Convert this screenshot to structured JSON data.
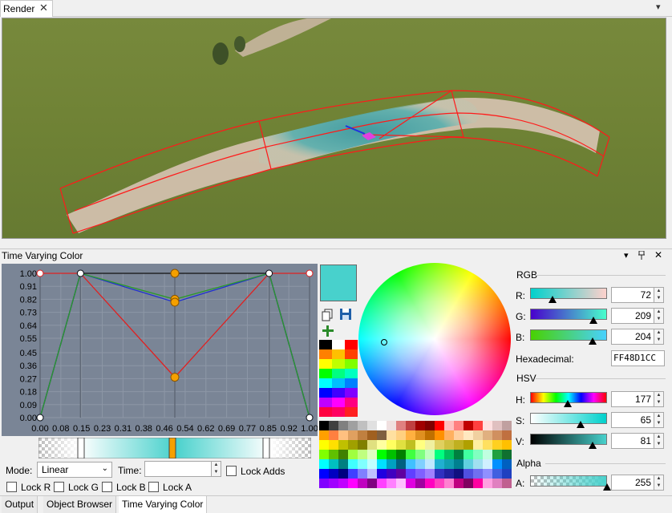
{
  "render_panel": {
    "tab_label": "Render",
    "close_glyph": "✕",
    "menu_glyph": "▾"
  },
  "tool_panel": {
    "title": "Time Varying Color",
    "header_buttons": {
      "menu": "▾",
      "pin": "📌",
      "close": "✕"
    }
  },
  "graph": {
    "y_ticks": [
      "1.00",
      "0.91",
      "0.82",
      "0.73",
      "0.64",
      "0.55",
      "0.45",
      "0.36",
      "0.27",
      "0.18",
      "0.09",
      "0.00"
    ],
    "x_ticks": [
      "0.00",
      "0.08",
      "0.15",
      "0.23",
      "0.31",
      "0.38",
      "0.46",
      "0.54",
      "0.62",
      "0.69",
      "0.77",
      "0.85",
      "0.92",
      "1.00"
    ],
    "keys": [
      {
        "t": 0.0,
        "r": 1.0,
        "g": 0.0,
        "b": 0.0,
        "a": 0.0
      },
      {
        "t": 0.15,
        "r": 1.0,
        "g": 1.0,
        "b": 1.0,
        "a": 1.0
      },
      {
        "t": 0.5,
        "r": 0.28,
        "g": 0.82,
        "b": 0.8,
        "a": 1.0
      },
      {
        "t": 0.85,
        "r": 1.0,
        "g": 1.0,
        "b": 1.0,
        "a": 1.0
      },
      {
        "t": 1.0,
        "r": 1.0,
        "g": 0.0,
        "b": 0.0,
        "a": 0.0
      }
    ],
    "colors": {
      "red": "#e02020",
      "green": "#2b9a2b",
      "blue": "#2030d0",
      "alpha": "#111111",
      "selected": "#f5a000"
    }
  },
  "controls": {
    "mode_label": "Mode:",
    "mode_value": "Linear",
    "time_label": "Time:",
    "time_value": "",
    "lock_adds": "Lock Adds",
    "lock_r": "Lock R",
    "lock_g": "Lock G",
    "lock_b": "Lock B",
    "lock_a": "Lock A"
  },
  "color": {
    "current": "#48d1cc",
    "rgb_title": "RGB",
    "r_label": "R:",
    "r_value": "72",
    "g_label": "G:",
    "g_value": "209",
    "b_label": "B:",
    "b_value": "204",
    "hex_label": "Hexadecimal:",
    "hex_value": "FF48D1CC",
    "hsv_title": "HSV",
    "h_label": "H:",
    "h_value": "177",
    "s_label": "S:",
    "s_value": "65",
    "v_label": "V:",
    "v_value": "81",
    "alpha_title": "Alpha",
    "a_label": "A:",
    "a_value": "255"
  },
  "bottom_tabs": [
    "Output",
    "Object Browser",
    "Time Varying Color"
  ],
  "icons": {
    "copy": "copy-icon",
    "save": "save-icon",
    "add": "plus-icon"
  }
}
